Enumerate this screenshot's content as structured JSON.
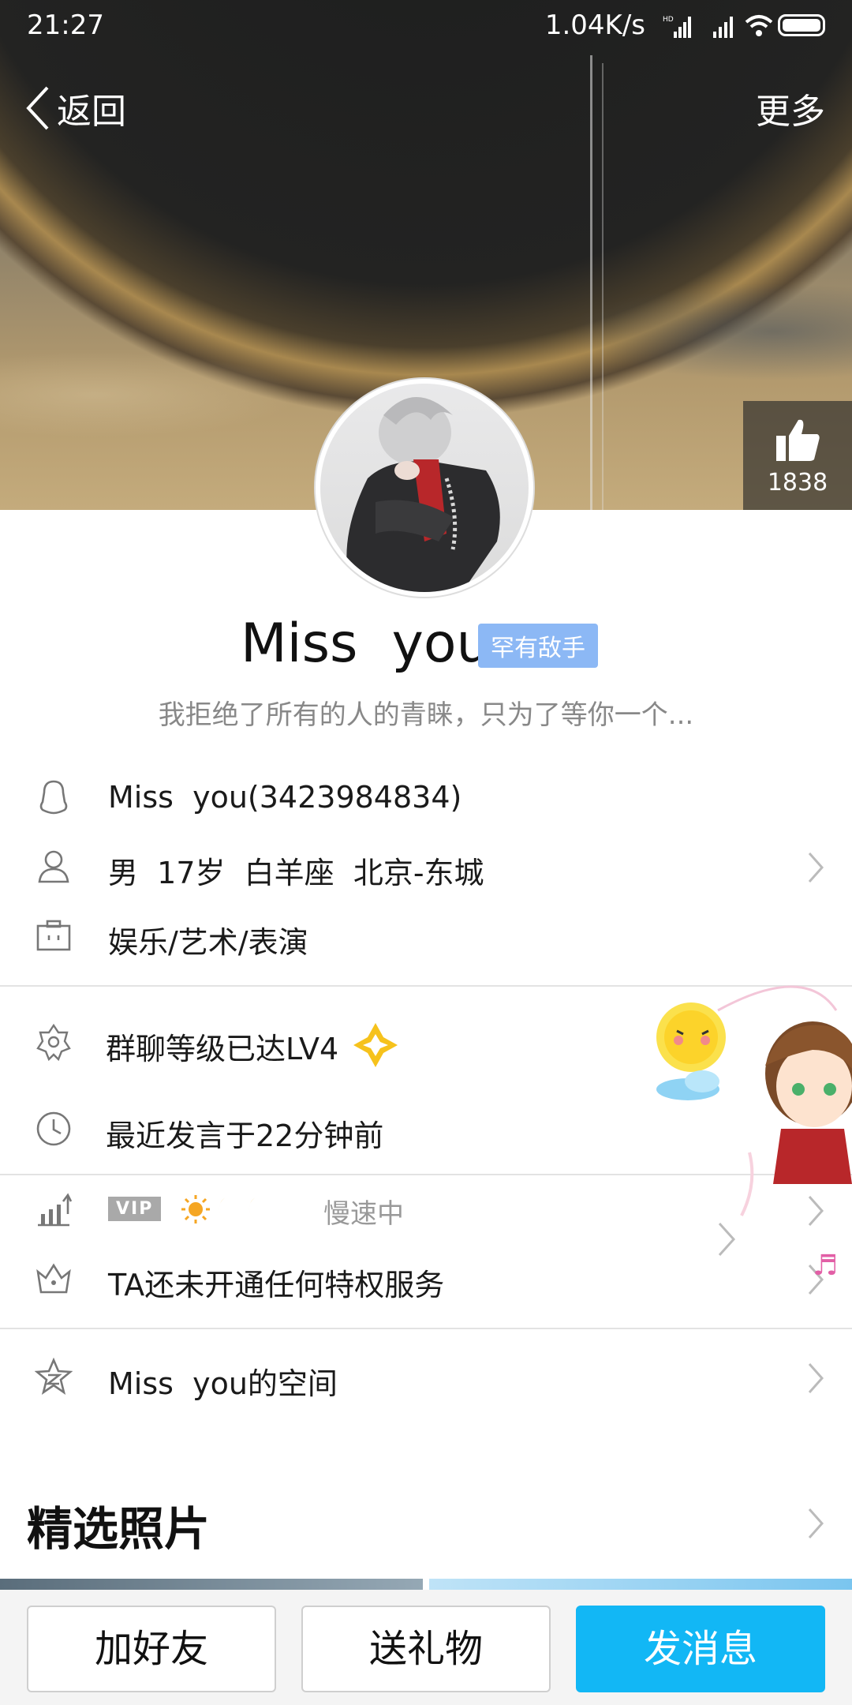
{
  "status_bar": {
    "time": "21:27",
    "speed": "1.04K/s",
    "hd_tag": "HD"
  },
  "nav": {
    "back_label": "返回",
    "more_label": "更多"
  },
  "like": {
    "count": "1838"
  },
  "profile": {
    "name": "Miss  you",
    "badge": "罕有敌手",
    "signature": "我拒绝了所有的人的青睐，只为了等你一个..."
  },
  "info": {
    "qq": "Miss  you(3423984834)",
    "basic": "男  17岁  白羊座  北京-东城",
    "job": "娱乐/艺术/表演"
  },
  "group": {
    "level": "群聊等级已达LV4",
    "last_spoken": "最近发言于22分钟前"
  },
  "vip": {
    "badge": "VIP",
    "status": "慢速中",
    "privilege": "TA还未开通任何特权服务"
  },
  "space": {
    "label": "Miss  you的空间"
  },
  "photos": {
    "title": "精选照片"
  },
  "actions": {
    "add_friend": "加好友",
    "send_gift": "送礼物",
    "send_message": "发消息"
  },
  "colors": {
    "primary": "#12b7f5",
    "badge": "#8cb8f5"
  }
}
